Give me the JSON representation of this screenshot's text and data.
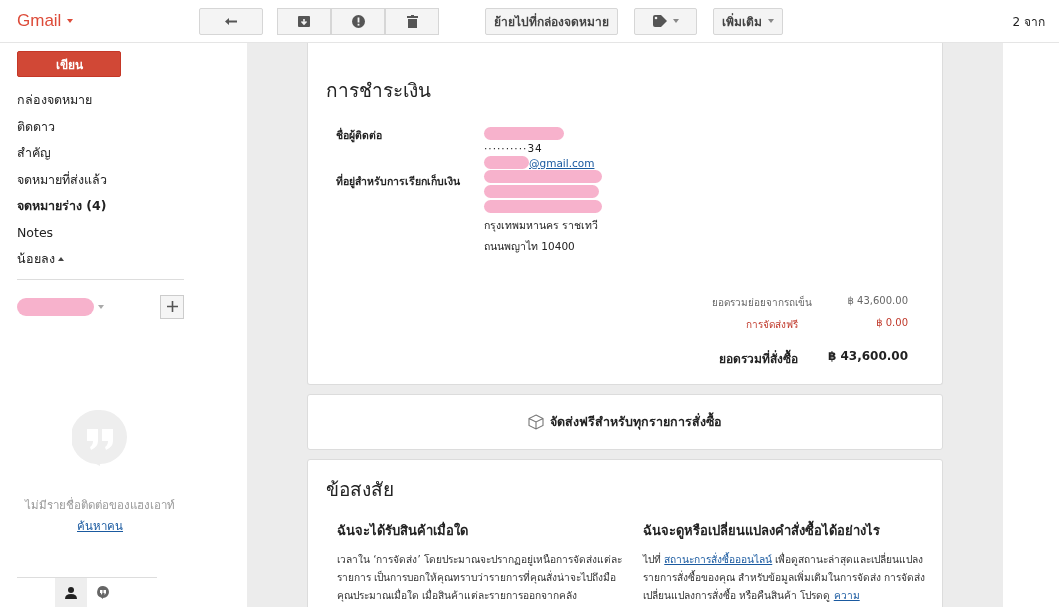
{
  "app": {
    "logo": "Gmail"
  },
  "toolbar": {
    "move_button": "ย้ายไปที่กล่องจดหมาย",
    "more_button": "เพิ่มเติม",
    "count": "2 จาก"
  },
  "sidebar": {
    "compose": "เขียน",
    "items": [
      {
        "label": "กล่องจดหมาย",
        "unread": false
      },
      {
        "label": "ติดดาว",
        "unread": false
      },
      {
        "label": "สำคัญ",
        "unread": false
      },
      {
        "label": "จดหมายที่ส่งแล้ว",
        "unread": false
      },
      {
        "label": "จดหมายร่าง (4)",
        "unread": true
      },
      {
        "label": "Notes",
        "unread": false
      }
    ],
    "less_toggle": "น้อยลง",
    "hangouts": {
      "empty_text": "ไม่มีรายชื่อติดต่อของแฮงเอาท์",
      "link": "ค้นหาคน"
    }
  },
  "payment": {
    "title": "การชำระเงิน",
    "contact_label": "ชื่อผู้ติดต่อ",
    "phone": "··········34",
    "email": "@gmail.com",
    "billing_label": "ที่อยู่สำหรับการเรียกเก็บเงิน",
    "address_lines": [
      "กรุงเทพมหานคร ราชเทวี",
      "ถนนพญาไท 10400"
    ],
    "totals": [
      {
        "kind": "subtotal",
        "label": "ยอดรวมย่อยจากรถเข็น",
        "value": "฿ 43,600.00"
      },
      {
        "kind": "shipping",
        "label": "การจัดส่งฟรี",
        "value": "฿ 0.00"
      },
      {
        "kind": "total",
        "label": "ยอดรวมที่สั่งซื้อ",
        "value": "฿ 43,600.00"
      }
    ]
  },
  "shipping_banner": "จัดส่งฟรีสำหรับทุกรายการสั่งซื้อ",
  "faq": {
    "title": "ข้อสงสัย",
    "questions": [
      {
        "title": "ฉันจะได้รับสินค้าเมื่อใด",
        "parts": [
          {
            "kind": "text",
            "text": "เวลาใน ‘การจัดส่ง’ โดยประมาณจะปรากฏอยู่เหนือการจัดส่งแต่ละรายการ เป็นการบอกให้คุณทราบว่ารายการที่คุณสั่งน่าจะไปถึงมือคุณประมาณเมื่อใด เมื่อสินค้าแต่ละรายการออกจากคลัง"
          }
        ]
      },
      {
        "title": "ฉันจะดูหรือเปลี่ยนแปลงคำสั่งซื้อได้อย่างไร",
        "parts": [
          {
            "kind": "text",
            "text": "ไปที่ "
          },
          {
            "kind": "link",
            "text": "สถานะการสั่งซื้อออนไลน์"
          },
          {
            "kind": "text",
            "text": " เพื่อดูสถานะล่าสุดและเปลี่ยนแปลงรายการสั่งซื้อของคุณ สำหรับข้อมูลเพิ่มเติมในการจัดส่ง การจัดส่ง เปลี่ยนแปลงการสั่งซื้อ หรือคืนสินค้า โปรดดู "
          },
          {
            "kind": "link",
            "text": "ความ"
          }
        ]
      }
    ]
  }
}
